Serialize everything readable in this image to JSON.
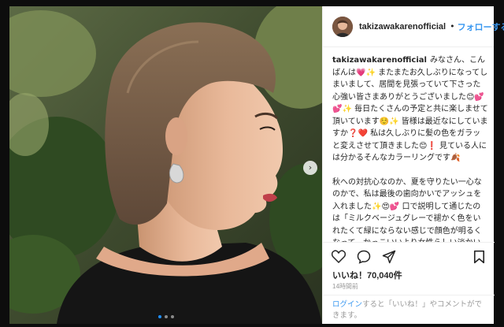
{
  "post": {
    "username": "takizawakarenofficial",
    "separator": "•",
    "follow_label": "フォローする",
    "caption_paragraphs": [
      "みなさん、こんばんは💗✨ またまたお久しぶりになってしまいまして、居間を見張っていて下さった心強い皆さまありがとうございました😊💕💕✨ 毎日たくさんの予定と共に楽しませて頂いています☺️✨ 皆様は最近なにしていますか❓❤️ 私は久しぶりに髪の色をガラッと変えさせて頂きました😊❗ 見ている人には分かるそんなカラーリングです🍂",
      "秋への対抗心なのか、夏を守りたい一心なのかで、私は最後の歯向かいでアッシュを入れました✨😍💕 口で説明して通じたのは「ミルクベージュグレーで褪かく色をいれたくて緑にならない感じで顔色が明るくなって、かっこいいより女性らしい淡かい色」というような雰囲気だったと思いますが、😊、私が想像してた理想をそっくりそのまま超えてきて私にとってはこんなに言いたかった色はないとまで思いました👍🏻💋 これで次の日曜されちゃうわけで、ナイスミッションかなしまた、後日ご紹介でもいたしましょうかね💇"
    ],
    "likes_text": "いいね！70,040件",
    "time_text": "14時間前",
    "login": {
      "link": "ログイン",
      "text": "すると「いいね！」やコメントができます。"
    }
  },
  "carousel": {
    "dot_count": 3,
    "active_index": 0
  },
  "icons": {
    "like": "heart-outline-icon",
    "comment": "comment-bubble-icon",
    "share": "paper-plane-icon",
    "save": "bookmark-icon",
    "next": "chevron-right-icon"
  },
  "colors": {
    "link_blue": "#3897f0",
    "text": "#262626",
    "muted": "#999999",
    "backdrop": "#0d0d0d"
  }
}
